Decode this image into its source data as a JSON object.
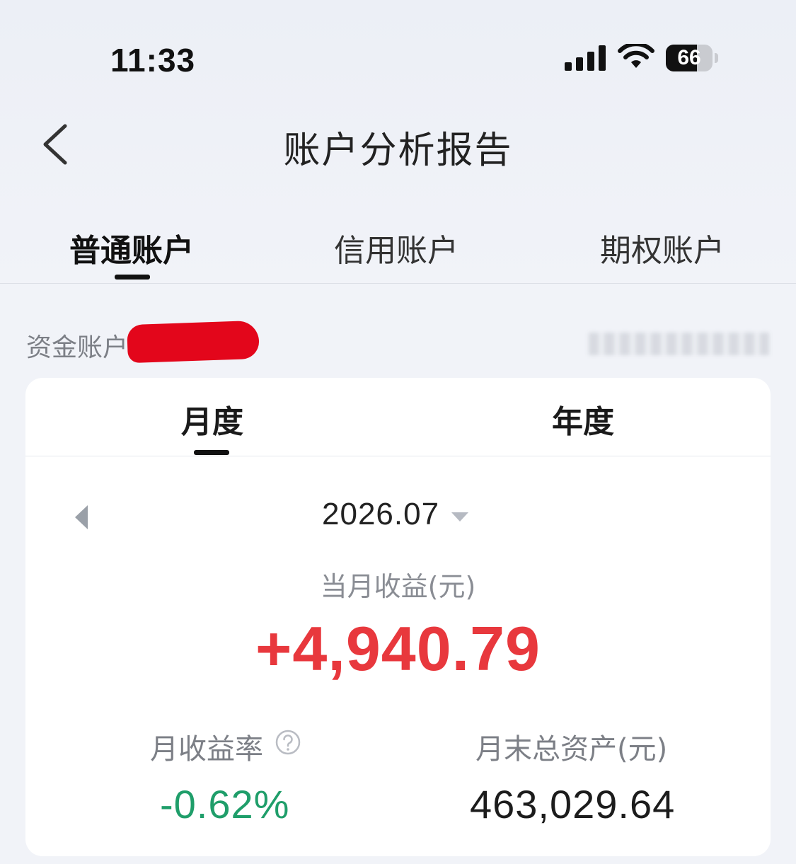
{
  "status_bar": {
    "time": "11:33",
    "battery_level": "66",
    "battery_fraction": 0.66,
    "icons": [
      "signal-icon",
      "wifi-icon",
      "battery-icon"
    ]
  },
  "nav": {
    "back_icon": "chevron-left-icon",
    "title": "账户分析报告"
  },
  "account_tabs": [
    {
      "label": "普通账户",
      "active": true
    },
    {
      "label": "信用账户",
      "active": false
    },
    {
      "label": "期权账户",
      "active": false
    }
  ],
  "fund_account": {
    "label": "资金账户:",
    "value_visible": "8"
  },
  "period_tabs": [
    {
      "label": "月度",
      "active": true
    },
    {
      "label": "年度",
      "active": false
    }
  ],
  "report": {
    "date": "2026.07",
    "income_label": "当月收益(元)",
    "income_value": "+4,940.79",
    "rate_label": "月收益率",
    "rate_value": "-0.62%",
    "assets_label": "月末总资产(元)",
    "assets_value": "463,029.64"
  },
  "colors": {
    "positive": "#e8383d",
    "negative": "#1f9e6a",
    "text_primary": "#1d1d1f",
    "text_secondary": "#7c7f86",
    "background": "#f1f3f8",
    "card": "#ffffff"
  }
}
